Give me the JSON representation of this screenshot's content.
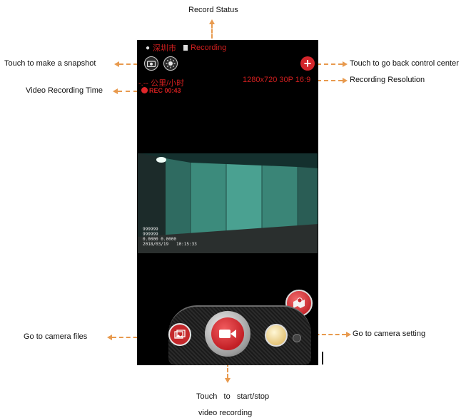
{
  "annotations": {
    "record_status": "Record Status",
    "snapshot": "Touch to make a snapshot",
    "back_control_center": "Touch to go back control center",
    "recording_time": "Video Recording Time",
    "recording_resolution": "Recording Resolution",
    "camera_files": "Go to camera files",
    "camera_setting": "Go to camera setting",
    "start_stop_line1": "Touch   to   start/stop",
    "start_stop_line2": "video recording"
  },
  "screen": {
    "location": "深圳市",
    "record_state": "Recording",
    "speed": "-.-- 公里/小时",
    "resolution": "1280x720 30P 16:9",
    "rec_time": "REC 00:43",
    "osd_line1": "999999",
    "osd_line2": "999999",
    "osd_line3": "0.0000 0.0000",
    "osd_line4": "2018/03/19   10:15:33"
  },
  "icons": {
    "location": "map-pin-icon",
    "sd_card": "sd-card-icon",
    "snapshot": "camera-icon",
    "brightness": "sun-icon",
    "back": "plus-icon",
    "files": "gallery-icon",
    "record": "video-camera-icon",
    "map": "map-marker-icon"
  },
  "colors": {
    "accent": "#d21f1f",
    "arrow": "#e89a4e",
    "screen_bg": "#000000"
  }
}
